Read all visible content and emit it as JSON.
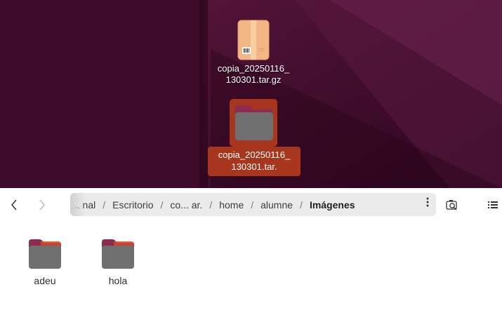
{
  "desktop": {
    "icons": [
      {
        "name_line1": "copia_20250116_",
        "name_line2": "130301.tar.gz",
        "icon": "archive-icon"
      },
      {
        "name_line1": "copia_20250116_",
        "name_line2": "130301.tar.",
        "icon": "folder-icon",
        "selected": true
      }
    ],
    "colors": {
      "wallpaper": "#3f0b29",
      "selection": "#a8361e"
    }
  },
  "file_manager": {
    "nav": {
      "back_icon": "chevron-left-icon",
      "forward_icon": "chevron-right-icon"
    },
    "pathbar": {
      "crumbs": [
        "... nal",
        "Escritorio",
        "co... ar.",
        "home",
        "alumne",
        "Imágenes"
      ],
      "separator": "/",
      "menu_icon": "vertical-ellipsis-icon"
    },
    "toolbar": {
      "search_icon": "search-icon",
      "view_icon": "list-view-icon"
    },
    "items": [
      {
        "label": "adeu",
        "icon": "folder-icon"
      },
      {
        "label": "hola",
        "icon": "folder-icon"
      }
    ],
    "colors": {
      "folder_tab": "#c7162b",
      "folder_body": "#737373",
      "accent": "#e95420"
    }
  }
}
